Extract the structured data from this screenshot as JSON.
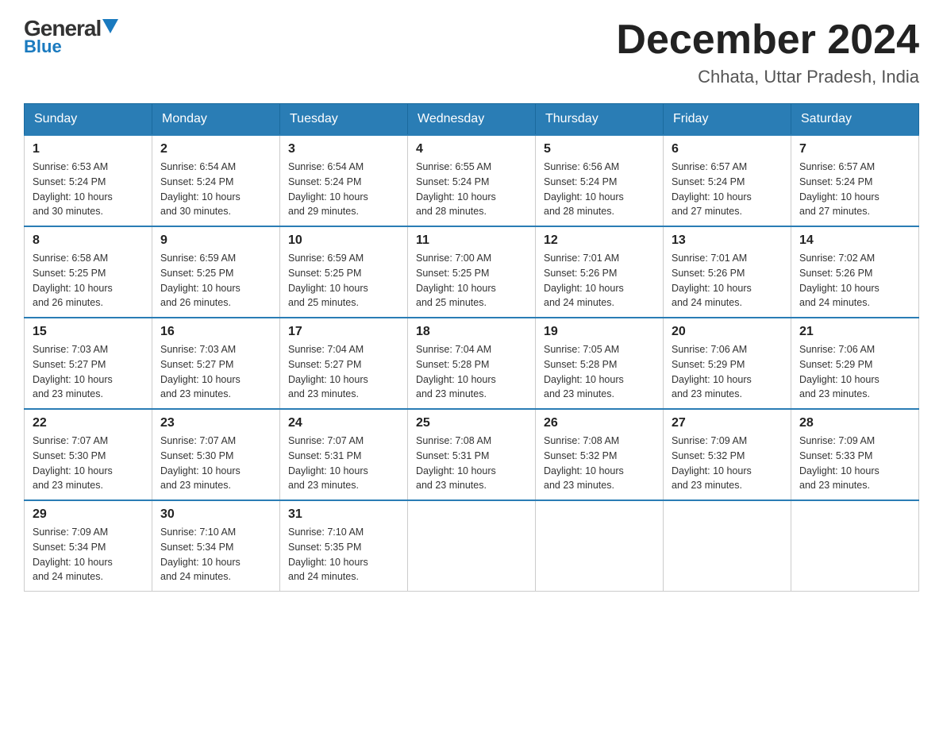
{
  "header": {
    "logo_general": "General",
    "logo_blue": "Blue",
    "month_title": "December 2024",
    "location": "Chhata, Uttar Pradesh, India"
  },
  "days_of_week": [
    "Sunday",
    "Monday",
    "Tuesday",
    "Wednesday",
    "Thursday",
    "Friday",
    "Saturday"
  ],
  "weeks": [
    [
      {
        "day": "1",
        "sunrise": "6:53 AM",
        "sunset": "5:24 PM",
        "daylight": "10 hours and 30 minutes."
      },
      {
        "day": "2",
        "sunrise": "6:54 AM",
        "sunset": "5:24 PM",
        "daylight": "10 hours and 30 minutes."
      },
      {
        "day": "3",
        "sunrise": "6:54 AM",
        "sunset": "5:24 PM",
        "daylight": "10 hours and 29 minutes."
      },
      {
        "day": "4",
        "sunrise": "6:55 AM",
        "sunset": "5:24 PM",
        "daylight": "10 hours and 28 minutes."
      },
      {
        "day": "5",
        "sunrise": "6:56 AM",
        "sunset": "5:24 PM",
        "daylight": "10 hours and 28 minutes."
      },
      {
        "day": "6",
        "sunrise": "6:57 AM",
        "sunset": "5:24 PM",
        "daylight": "10 hours and 27 minutes."
      },
      {
        "day": "7",
        "sunrise": "6:57 AM",
        "sunset": "5:24 PM",
        "daylight": "10 hours and 27 minutes."
      }
    ],
    [
      {
        "day": "8",
        "sunrise": "6:58 AM",
        "sunset": "5:25 PM",
        "daylight": "10 hours and 26 minutes."
      },
      {
        "day": "9",
        "sunrise": "6:59 AM",
        "sunset": "5:25 PM",
        "daylight": "10 hours and 26 minutes."
      },
      {
        "day": "10",
        "sunrise": "6:59 AM",
        "sunset": "5:25 PM",
        "daylight": "10 hours and 25 minutes."
      },
      {
        "day": "11",
        "sunrise": "7:00 AM",
        "sunset": "5:25 PM",
        "daylight": "10 hours and 25 minutes."
      },
      {
        "day": "12",
        "sunrise": "7:01 AM",
        "sunset": "5:26 PM",
        "daylight": "10 hours and 24 minutes."
      },
      {
        "day": "13",
        "sunrise": "7:01 AM",
        "sunset": "5:26 PM",
        "daylight": "10 hours and 24 minutes."
      },
      {
        "day": "14",
        "sunrise": "7:02 AM",
        "sunset": "5:26 PM",
        "daylight": "10 hours and 24 minutes."
      }
    ],
    [
      {
        "day": "15",
        "sunrise": "7:03 AM",
        "sunset": "5:27 PM",
        "daylight": "10 hours and 23 minutes."
      },
      {
        "day": "16",
        "sunrise": "7:03 AM",
        "sunset": "5:27 PM",
        "daylight": "10 hours and 23 minutes."
      },
      {
        "day": "17",
        "sunrise": "7:04 AM",
        "sunset": "5:27 PM",
        "daylight": "10 hours and 23 minutes."
      },
      {
        "day": "18",
        "sunrise": "7:04 AM",
        "sunset": "5:28 PM",
        "daylight": "10 hours and 23 minutes."
      },
      {
        "day": "19",
        "sunrise": "7:05 AM",
        "sunset": "5:28 PM",
        "daylight": "10 hours and 23 minutes."
      },
      {
        "day": "20",
        "sunrise": "7:06 AM",
        "sunset": "5:29 PM",
        "daylight": "10 hours and 23 minutes."
      },
      {
        "day": "21",
        "sunrise": "7:06 AM",
        "sunset": "5:29 PM",
        "daylight": "10 hours and 23 minutes."
      }
    ],
    [
      {
        "day": "22",
        "sunrise": "7:07 AM",
        "sunset": "5:30 PM",
        "daylight": "10 hours and 23 minutes."
      },
      {
        "day": "23",
        "sunrise": "7:07 AM",
        "sunset": "5:30 PM",
        "daylight": "10 hours and 23 minutes."
      },
      {
        "day": "24",
        "sunrise": "7:07 AM",
        "sunset": "5:31 PM",
        "daylight": "10 hours and 23 minutes."
      },
      {
        "day": "25",
        "sunrise": "7:08 AM",
        "sunset": "5:31 PM",
        "daylight": "10 hours and 23 minutes."
      },
      {
        "day": "26",
        "sunrise": "7:08 AM",
        "sunset": "5:32 PM",
        "daylight": "10 hours and 23 minutes."
      },
      {
        "day": "27",
        "sunrise": "7:09 AM",
        "sunset": "5:32 PM",
        "daylight": "10 hours and 23 minutes."
      },
      {
        "day": "28",
        "sunrise": "7:09 AM",
        "sunset": "5:33 PM",
        "daylight": "10 hours and 23 minutes."
      }
    ],
    [
      {
        "day": "29",
        "sunrise": "7:09 AM",
        "sunset": "5:34 PM",
        "daylight": "10 hours and 24 minutes."
      },
      {
        "day": "30",
        "sunrise": "7:10 AM",
        "sunset": "5:34 PM",
        "daylight": "10 hours and 24 minutes."
      },
      {
        "day": "31",
        "sunrise": "7:10 AM",
        "sunset": "5:35 PM",
        "daylight": "10 hours and 24 minutes."
      },
      null,
      null,
      null,
      null
    ]
  ],
  "labels": {
    "sunrise_prefix": "Sunrise: ",
    "sunset_prefix": "Sunset: ",
    "daylight_prefix": "Daylight: "
  }
}
